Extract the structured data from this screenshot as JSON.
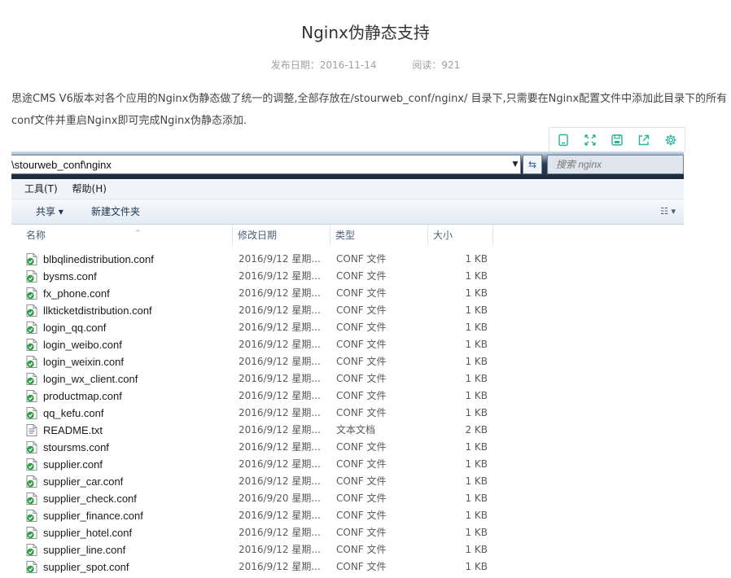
{
  "article": {
    "title": "Nginx伪静态支持",
    "date": "发布日期：2016-11-14",
    "reads": "阅读：921",
    "intro": "思途CMS V6版本对各个应用的Nginx伪静态做了统一的调整,全部存放在/stourweb_conf/nginx/ 目录下,只需要在Nginx配置文件中添加此目录下的所有conf文件并重启Nginx即可完成Nginx伪静态添加."
  },
  "toolbar_icons": [
    "bookmark-icon",
    "expand-icon",
    "save-icon",
    "share-icon",
    "settings-icon"
  ],
  "explorer": {
    "address": "\\stourweb_conf\\nginx",
    "search_placeholder": "搜索 nginx",
    "menu": [
      "工具(T)",
      "帮助(H)"
    ],
    "commands": {
      "share": "共享 ▾",
      "new_folder": "新建文件夹"
    },
    "columns": [
      "名称",
      "修改日期",
      "类型",
      "大小"
    ],
    "files": [
      {
        "name": "blbqlinedistribution.conf",
        "date": "2016/9/12 星期...",
        "type": "CONF 文件",
        "size": "1 KB"
      },
      {
        "name": "bysms.conf",
        "date": "2016/9/12 星期...",
        "type": "CONF 文件",
        "size": "1 KB"
      },
      {
        "name": "fx_phone.conf",
        "date": "2016/9/12 星期...",
        "type": "CONF 文件",
        "size": "1 KB"
      },
      {
        "name": "llkticketdistribution.conf",
        "date": "2016/9/12 星期...",
        "type": "CONF 文件",
        "size": "1 KB"
      },
      {
        "name": "login_qq.conf",
        "date": "2016/9/12 星期...",
        "type": "CONF 文件",
        "size": "1 KB"
      },
      {
        "name": "login_weibo.conf",
        "date": "2016/9/12 星期...",
        "type": "CONF 文件",
        "size": "1 KB"
      },
      {
        "name": "login_weixin.conf",
        "date": "2016/9/12 星期...",
        "type": "CONF 文件",
        "size": "1 KB"
      },
      {
        "name": "login_wx_client.conf",
        "date": "2016/9/12 星期...",
        "type": "CONF 文件",
        "size": "1 KB"
      },
      {
        "name": "productmap.conf",
        "date": "2016/9/12 星期...",
        "type": "CONF 文件",
        "size": "1 KB"
      },
      {
        "name": "qq_kefu.conf",
        "date": "2016/9/12 星期...",
        "type": "CONF 文件",
        "size": "1 KB"
      },
      {
        "name": "README.txt",
        "date": "2016/9/12 星期...",
        "type": "文本文档",
        "size": "2 KB"
      },
      {
        "name": "stoursms.conf",
        "date": "2016/9/12 星期...",
        "type": "CONF 文件",
        "size": "1 KB"
      },
      {
        "name": "supplier.conf",
        "date": "2016/9/12 星期...",
        "type": "CONF 文件",
        "size": "1 KB"
      },
      {
        "name": "supplier_car.conf",
        "date": "2016/9/12 星期...",
        "type": "CONF 文件",
        "size": "1 KB"
      },
      {
        "name": "supplier_check.conf",
        "date": "2016/9/20 星期...",
        "type": "CONF 文件",
        "size": "1 KB"
      },
      {
        "name": "supplier_finance.conf",
        "date": "2016/9/12 星期...",
        "type": "CONF 文件",
        "size": "1 KB"
      },
      {
        "name": "supplier_hotel.conf",
        "date": "2016/9/12 星期...",
        "type": "CONF 文件",
        "size": "1 KB"
      },
      {
        "name": "supplier_line.conf",
        "date": "2016/9/12 星期...",
        "type": "CONF 文件",
        "size": "1 KB"
      },
      {
        "name": "supplier_spot.conf",
        "date": "2016/9/12 星期...",
        "type": "CONF 文件",
        "size": "1 KB"
      }
    ]
  },
  "colors": {
    "toolbar_icon": "#27b29a",
    "file_badge": "#2ea043"
  }
}
